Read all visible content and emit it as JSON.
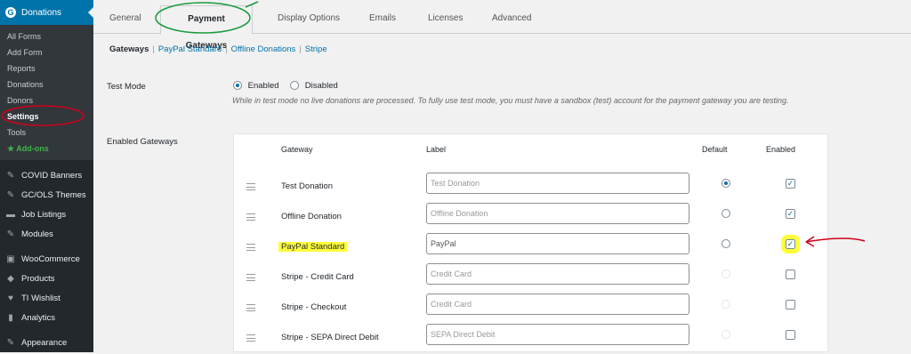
{
  "sidebar": {
    "top_label": "Donations",
    "sub_items": [
      "All Forms",
      "Add Form",
      "Reports",
      "Donations",
      "Donors",
      "Settings",
      "Tools",
      "★ Add-ons"
    ],
    "main_items": [
      {
        "label": "COVID Banners",
        "icon": "pin-icon"
      },
      {
        "label": "GC/OLS Themes",
        "icon": "pin-icon"
      },
      {
        "label": "Job Listings",
        "icon": "briefcase-icon"
      },
      {
        "label": "Modules",
        "icon": "pin-icon"
      },
      {
        "label": "WooCommerce",
        "icon": "woocommerce-icon"
      },
      {
        "label": "Products",
        "icon": "box-icon"
      },
      {
        "label": "TI Wishlist",
        "icon": "heart-icon"
      },
      {
        "label": "Analytics",
        "icon": "bar-chart-icon"
      },
      {
        "label": "Appearance",
        "icon": "brush-icon"
      }
    ]
  },
  "tabs": [
    "General",
    "Payment Gateways",
    "Display Options",
    "Emails",
    "Licenses",
    "Advanced"
  ],
  "subnav": {
    "current": "Gateways",
    "links": [
      "PayPal Standard",
      "Offline Donations",
      "Stripe"
    ]
  },
  "test_mode": {
    "label": "Test Mode",
    "enabled_label": "Enabled",
    "disabled_label": "Disabled",
    "description": "While in test mode no live donations are processed. To fully use test mode, you must have a sandbox (test) account for the payment gateway you are testing."
  },
  "gateways": {
    "label": "Enabled Gateways",
    "headers": {
      "gateway": "Gateway",
      "label": "Label",
      "default": "Default",
      "enabled": "Enabled"
    },
    "rows": [
      {
        "name": "Test Donation",
        "placeholder": "Test Donation",
        "default": true,
        "enabled": true
      },
      {
        "name": "Offline Donation",
        "placeholder": "Offline Donation",
        "default": false,
        "enabled": true
      },
      {
        "name": "PayPal Standard",
        "placeholder": "PayPal",
        "default": false,
        "enabled": true
      },
      {
        "name": "Stripe - Credit Card",
        "placeholder": "Credit Card",
        "default": false,
        "enabled": false
      },
      {
        "name": "Stripe - Checkout",
        "placeholder": "Credit Card",
        "default": false,
        "enabled": false
      },
      {
        "name": "Stripe - SEPA Direct Debit",
        "placeholder": "SEPA Direct Debit",
        "default": false,
        "enabled": false
      }
    ]
  },
  "colors": {
    "accent": "#0073aa",
    "sidebar": "#23282d",
    "highlight": "#ffff3a",
    "annotation": "#d0021b"
  }
}
